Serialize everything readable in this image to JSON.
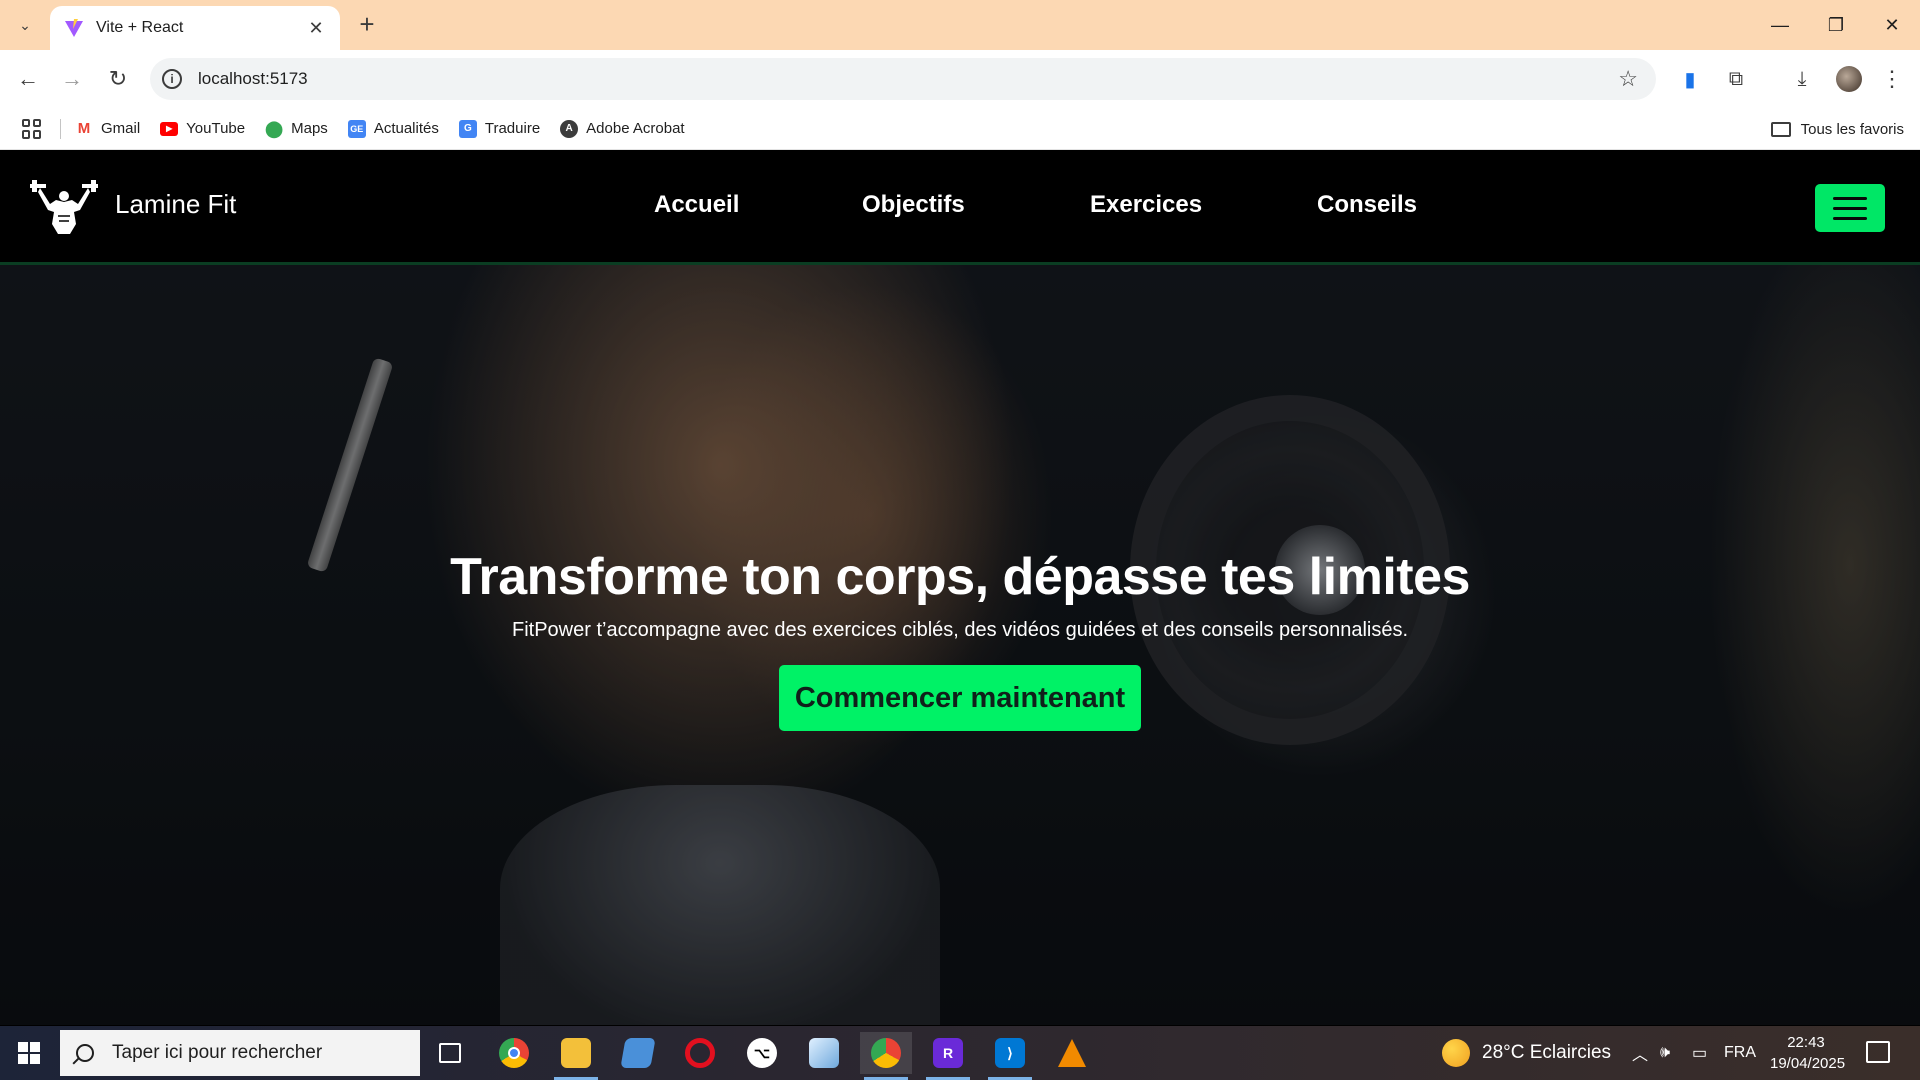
{
  "browser": {
    "tab_title": "Vite + React",
    "url": "localhost:5173",
    "bookmarks": [
      {
        "label": "Gmail",
        "icon": "gmail-icon",
        "color": "#ea4335"
      },
      {
        "label": "YouTube",
        "icon": "youtube-icon",
        "color": "#ff0000"
      },
      {
        "label": "Maps",
        "icon": "maps-icon",
        "color": "#34a853"
      },
      {
        "label": "Actualités",
        "icon": "news-icon",
        "color": "#4285f4"
      },
      {
        "label": "Traduire",
        "icon": "translate-icon",
        "color": "#4285f4"
      },
      {
        "label": "Adobe Acrobat",
        "icon": "acrobat-icon",
        "color": "#3c3c3c"
      }
    ],
    "all_bookmarks": "Tous les favoris",
    "chrome_color": "#fcd8b3"
  },
  "site": {
    "brand": "Lamine Fit",
    "menu": [
      "Accueil",
      "Objectifs",
      "Exercices",
      "Conseils"
    ],
    "accent": "#00f266"
  },
  "hero": {
    "title": "Transforme ton corps, dépasse tes limites",
    "subtitle": "FitPower t’accompagne avec des exercices ciblés, des vidéos guidées et des conseils personnalisés.",
    "cta": "Commencer maintenant"
  },
  "taskbar": {
    "search_placeholder": "Taper ici pour rechercher",
    "weather": "28°C  Eclaircies",
    "language": "FRA",
    "time": "22:43",
    "date": "19/04/2025"
  }
}
